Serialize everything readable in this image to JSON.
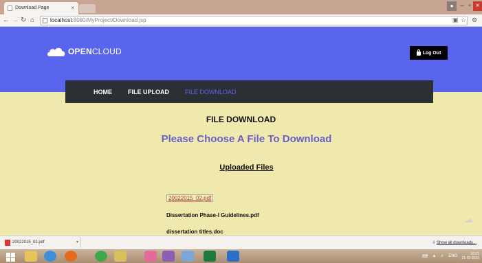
{
  "browser": {
    "tab_title": "Download Page",
    "tab_close": "×",
    "url_host": "localhost",
    "url_path": ":8080/MyProject/Download.jsp"
  },
  "header": {
    "brand_bold": "OPEN",
    "brand_rest": "CLOUD",
    "logout_label": "Log Out"
  },
  "menu": {
    "items": [
      {
        "label": "HOME"
      },
      {
        "label": "FILE UPLOAD"
      },
      {
        "label": "FILE DOWNLOAD"
      }
    ]
  },
  "main": {
    "title": "FILE DOWNLOAD",
    "subtitle": "Please Choose A File To Download",
    "uploaded_heading": "Uploaded Files",
    "files": [
      {
        "name": "20022015_02.pdf"
      },
      {
        "name": "Dissertation Phase-I Guidelines.pdf"
      },
      {
        "name": "dissertation titles.doc"
      }
    ]
  },
  "downloads": {
    "item": "20022015_02.pdf",
    "show_all": "Show all downloads..."
  },
  "taskbar": {
    "lang": "ENG",
    "time": "16:21",
    "date": "21-03-2015"
  },
  "colors": {
    "header_bg": "#5865ec",
    "menu_bg": "#2c2f34",
    "page_bg": "#f0e9ad",
    "subtitle": "#6a5fc7"
  }
}
